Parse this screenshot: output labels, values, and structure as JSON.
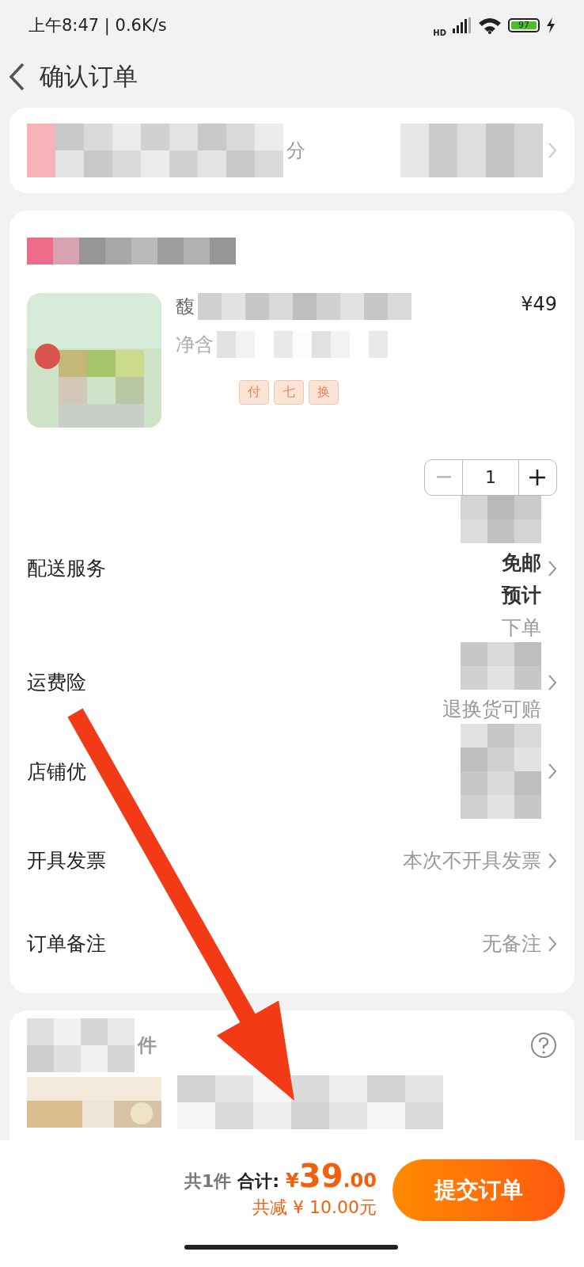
{
  "status_bar": {
    "time": "上午8:47 | 0.6K/s",
    "network": "HD",
    "battery": "97"
  },
  "header": {
    "title": "确认订单"
  },
  "address": {
    "fragment": "分"
  },
  "product": {
    "title_fragment": "馥",
    "spec_fragment": "净含",
    "tags": [
      "付",
      "七",
      "换"
    ],
    "price": "¥49",
    "quantity": "1"
  },
  "rows": [
    {
      "label": "配送服务",
      "masked": true,
      "lines": [
        {
          "text": "免邮",
          "kind": "strong"
        },
        {
          "text": "预计",
          "kind": "strong"
        },
        {
          "text": "下单",
          "kind": "muted"
        }
      ]
    },
    {
      "label": "运费险",
      "masked": true,
      "lines": [
        {
          "text": "退换货可赔",
          "kind": "muted"
        }
      ]
    },
    {
      "label": "店铺优",
      "masked": true,
      "lines": []
    },
    {
      "label": "开具发票",
      "masked": false,
      "lines": [
        {
          "text": "本次不开具发票",
          "kind": "muted"
        }
      ]
    },
    {
      "label": "订单备注",
      "masked": false,
      "lines": [
        {
          "text": "无备注",
          "kind": "muted"
        }
      ]
    }
  ],
  "extra": {
    "fragment": "件"
  },
  "footer": {
    "count": "共1件",
    "total_label": "合计:",
    "currency": "¥",
    "total_int": "39",
    "total_dec": ".00",
    "discount": "共减 ¥ 10.00元",
    "submit": "提交订单"
  }
}
